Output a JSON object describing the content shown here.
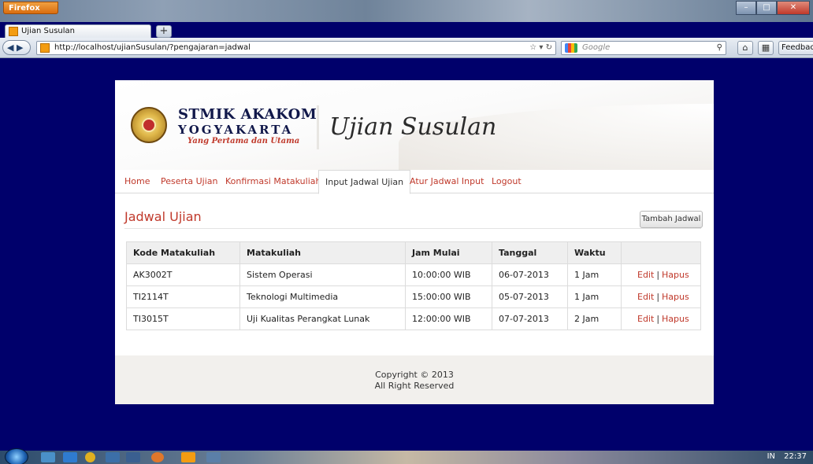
{
  "browser": {
    "menu_button": "Firefox",
    "tab_title": "Ujian Susulan",
    "new_tab": "+",
    "url": "http://localhost/ujianSusulan/?pengajaran=jadwal",
    "search_placeholder": "Google",
    "feedback_label": "Feedback"
  },
  "header": {
    "brand_line1": "STMIK AKAKOM",
    "brand_line2": "YOGYAKARTA",
    "brand_tagline": "Yang Pertama dan Utama",
    "app_title": "Ujian Susulan"
  },
  "menu": [
    {
      "label": "Home",
      "active": false
    },
    {
      "label": "Peserta Ujian",
      "active": false
    },
    {
      "label": "Konfirmasi Matakuliah",
      "active": false
    },
    {
      "label": "Input Jadwal Ujian",
      "active": true
    },
    {
      "label": "Atur Jadwal Input",
      "active": false
    },
    {
      "label": "Logout",
      "active": false
    }
  ],
  "main": {
    "heading": "Jadwal Ujian",
    "add_button": "Tambah Jadwal",
    "columns": [
      "Kode Matakuliah",
      "Matakuliah",
      "Jam Mulai",
      "Tanggal",
      "Waktu",
      ""
    ],
    "rows": [
      {
        "kode": "AK3002T",
        "matakuliah": "Sistem Operasi",
        "jam": "10:00:00 WIB",
        "tanggal": "06-07-2013",
        "waktu": "1 Jam",
        "edit": "Edit",
        "sep": "|",
        "hapus": "Hapus"
      },
      {
        "kode": "TI2114T",
        "matakuliah": "Teknologi Multimedia",
        "jam": "15:00:00 WIB",
        "tanggal": "05-07-2013",
        "waktu": "1 Jam",
        "edit": "Edit",
        "sep": "|",
        "hapus": "Hapus"
      },
      {
        "kode": "TI3015T",
        "matakuliah": "Uji Kualitas Perangkat Lunak",
        "jam": "12:00:00 WIB",
        "tanggal": "07-07-2013",
        "waktu": "2 Jam",
        "edit": "Edit",
        "sep": "|",
        "hapus": "Hapus"
      }
    ]
  },
  "footer": {
    "line1": "Copyright © 2013",
    "line2": "All Right Reserved"
  },
  "taskbar": {
    "tray_text": "IN",
    "clock": "22:37"
  },
  "colors": {
    "page_background": "#00006b",
    "accent": "#c0392b"
  }
}
